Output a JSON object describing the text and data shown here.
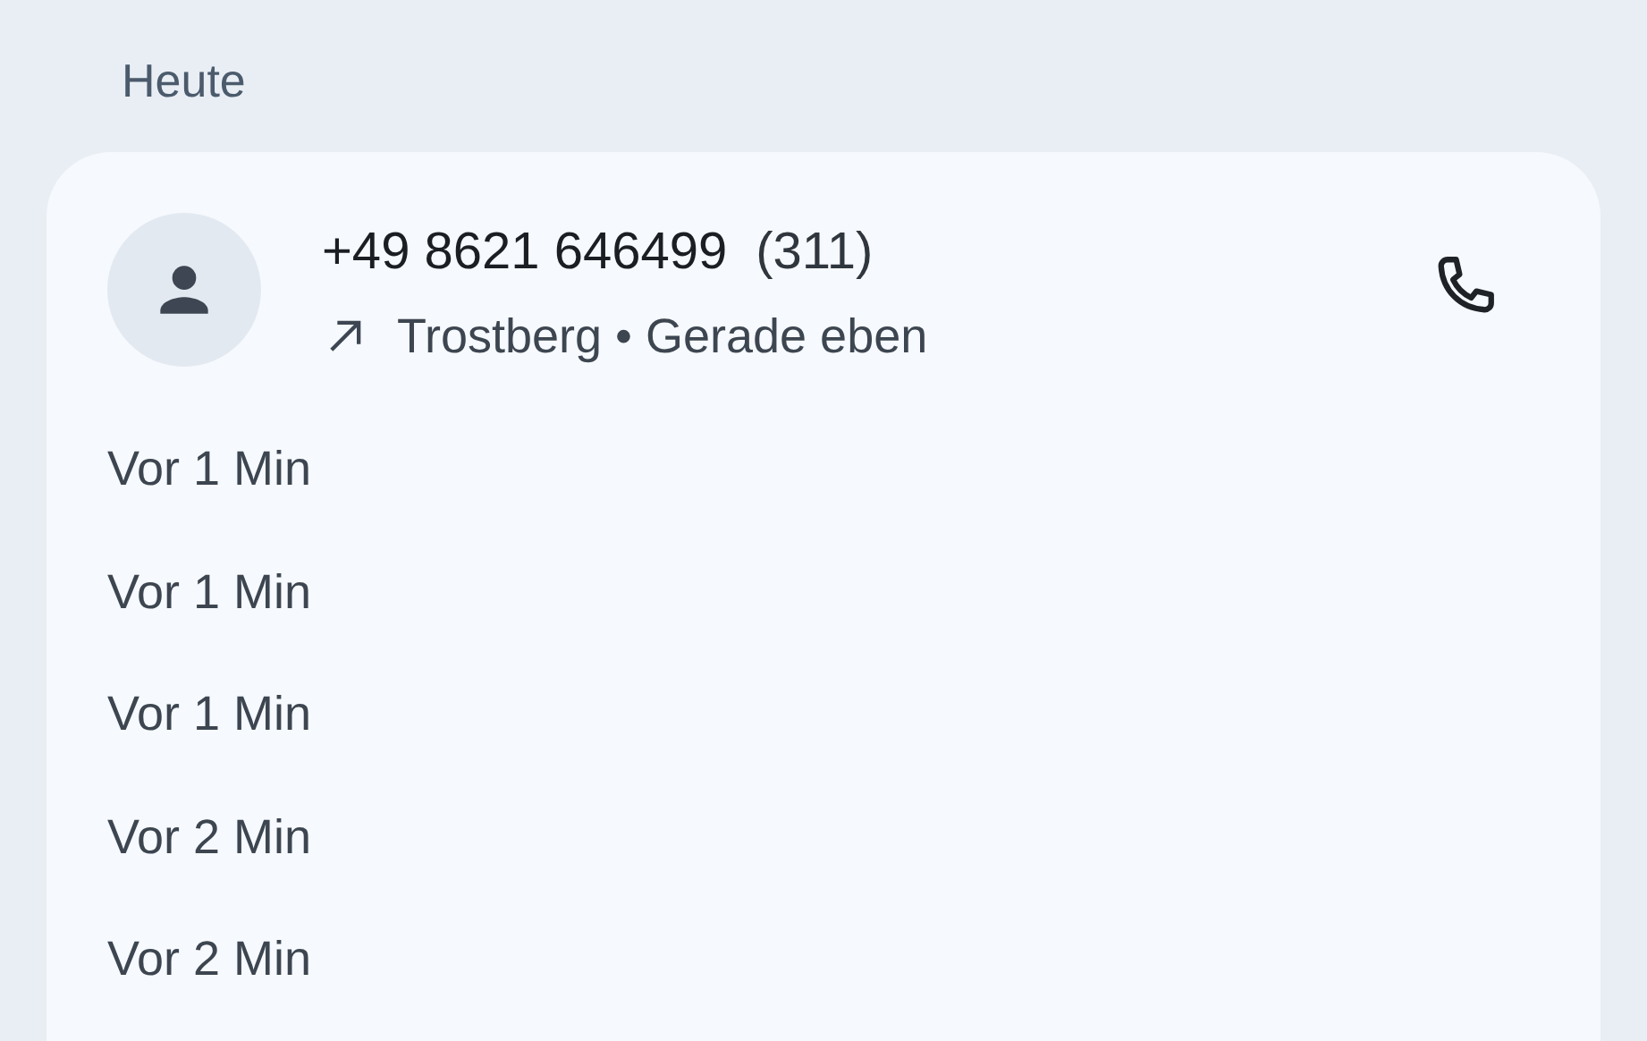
{
  "section": "Heute",
  "call": {
    "number": "+49 8621 646499",
    "count": "(311)",
    "kind": "outgoing",
    "detail": "Trostberg • Gerade eben"
  },
  "history": [
    "Vor 1 Min",
    "Vor 1 Min",
    "Vor 1 Min",
    "Vor 2 Min",
    "Vor 2 Min"
  ]
}
